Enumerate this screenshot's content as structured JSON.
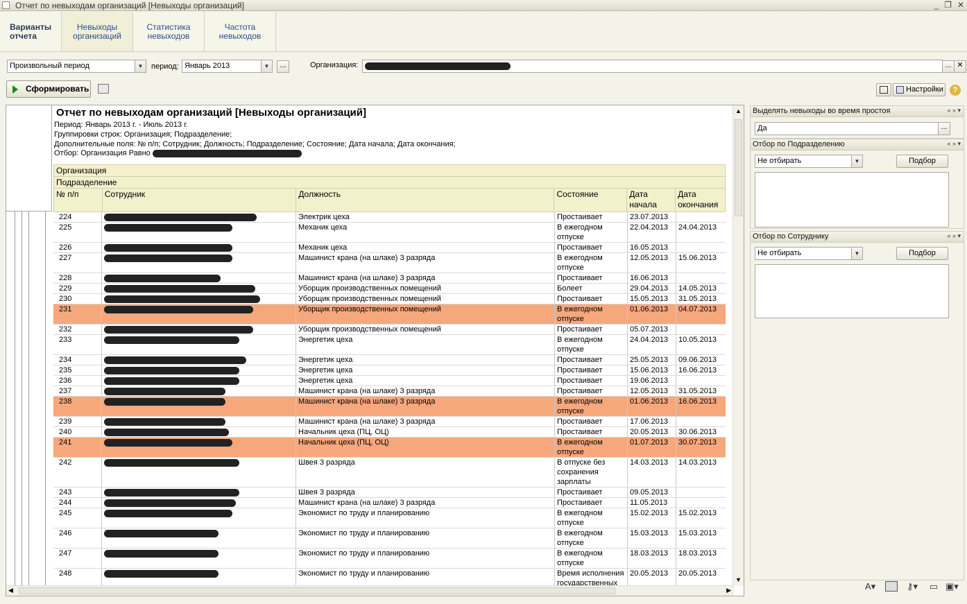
{
  "window": {
    "title": "Отчет по невыходам организаций [Невыходы организаций]",
    "buttons": [
      "_",
      "❐",
      "✕"
    ]
  },
  "tabs": [
    {
      "label": "Варианты отчета"
    },
    {
      "label": "Невыходы организаций"
    },
    {
      "label": "Статистика невыходов"
    },
    {
      "label": "Частота невыходов"
    }
  ],
  "filters": {
    "period_type": "Произвольный период",
    "period_label": "период:",
    "period_value": "Январь 2013",
    "ellipsis": "...",
    "org_label": "Организация:",
    "clear": "✕"
  },
  "toolbar": {
    "generate": "Сформировать",
    "settings": "Настройки",
    "help": "?"
  },
  "report": {
    "title": "Отчет по невыходам организаций [Невыходы организаций]",
    "period": "Период: Январь 2013 г. - Июль 2013 г.",
    "groupings": "Группировки строк: Организация; Подразделение;",
    "extra_fields": "Дополнительные поля: № п/п; Сотрудник; Должность; Подразделение; Состояние; Дата начала; Дата окончания;",
    "filter": "Отбор: Организация Равно",
    "group1": "Организация",
    "group2": "Подразделение",
    "columns": [
      "№ п/п",
      "Сотрудник",
      "Должность",
      "Состояние",
      "Дата начала",
      "Дата окончания"
    ],
    "rows": [
      {
        "n": "224",
        "pos": "Электрик цеха",
        "state": "Простаивает",
        "start": "23.07.2013",
        "end": "",
        "w": 220,
        "h": 1,
        "hl": false
      },
      {
        "n": "225",
        "pos": "Механик цеха",
        "state": "В ежегодном отпуске",
        "start": "22.04.2013",
        "end": "24.04.2013",
        "w": 185,
        "h": 2,
        "hl": false
      },
      {
        "n": "226",
        "pos": "Механик цеха",
        "state": "Простаивает",
        "start": "16.05.2013",
        "end": "",
        "w": 185,
        "h": 1,
        "hl": false
      },
      {
        "n": "227",
        "pos": "Машинист крана (на шлаке) 3 разряда",
        "state": "В ежегодном отпуске",
        "start": "12.05.2013",
        "end": "15.06.2013",
        "w": 185,
        "h": 2,
        "hl": false
      },
      {
        "n": "228",
        "pos": "Машинист крана (на шлаке) 3 разряда",
        "state": "Простаивает",
        "start": "16.06.2013",
        "end": "",
        "w": 168,
        "h": 1,
        "hl": false
      },
      {
        "n": "229",
        "pos": "Уборщик производственных помещений",
        "state": "Болеет",
        "start": "29.04.2013",
        "end": "14.05.2013",
        "w": 218,
        "h": 1,
        "hl": false
      },
      {
        "n": "230",
        "pos": "Уборщик производственных помещений",
        "state": "Простаивает",
        "start": "15.05.2013",
        "end": "31.05.2013",
        "w": 225,
        "h": 1,
        "hl": false
      },
      {
        "n": "231",
        "pos": "Уборщик производственных помещений",
        "state": "В ежегодном отпуске",
        "start": "01.06.2013",
        "end": "04.07.2013",
        "w": 215,
        "h": 2,
        "hl": true
      },
      {
        "n": "232",
        "pos": "Уборщик производственных помещений",
        "state": "Простаивает",
        "start": "05.07.2013",
        "end": "",
        "w": 215,
        "h": 1,
        "hl": false
      },
      {
        "n": "233",
        "pos": "Энергетик цеха",
        "state": "В ежегодном отпуске",
        "start": "24.04.2013",
        "end": "10.05.2013",
        "w": 195,
        "h": 2,
        "hl": false
      },
      {
        "n": "234",
        "pos": "Энергетик цеха",
        "state": "Простаивает",
        "start": "25.05.2013",
        "end": "09.06.2013",
        "w": 205,
        "h": 1,
        "hl": false
      },
      {
        "n": "235",
        "pos": "Энергетик цеха",
        "state": "Простаивает",
        "start": "15.06.2013",
        "end": "16.06.2013",
        "w": 195,
        "h": 1,
        "hl": false
      },
      {
        "n": "236",
        "pos": "Энергетик цеха",
        "state": "Простаивает",
        "start": "19.06.2013",
        "end": "",
        "w": 195,
        "h": 1,
        "hl": false
      },
      {
        "n": "237",
        "pos": "Машинист крана (на шлаке) 3 разряда",
        "state": "Простаивает",
        "start": "12.05.2013",
        "end": "31.05.2013",
        "w": 175,
        "h": 1,
        "hl": false
      },
      {
        "n": "238",
        "pos": "Машинист крана (на шлаке) 3 разряда",
        "state": "В ежегодном отпуске",
        "start": "01.06.2013",
        "end": "16.06.2013",
        "w": 175,
        "h": 2,
        "hl": true
      },
      {
        "n": "239",
        "pos": "Машинист крана (на шлаке) 3 разряда",
        "state": "Простаивает",
        "start": "17.06.2013",
        "end": "",
        "w": 175,
        "h": 1,
        "hl": false
      },
      {
        "n": "240",
        "pos": "Начальник цеха (ПЦ, ОЦ)",
        "state": "Простаивает",
        "start": "20.05.2013",
        "end": "30.06.2013",
        "w": 180,
        "h": 1,
        "hl": false
      },
      {
        "n": "241",
        "pos": "Начальник цеха (ПЦ, ОЦ)",
        "state": "В ежегодном отпуске",
        "start": "01.07.2013",
        "end": "30.07.2013",
        "w": 185,
        "h": 2,
        "hl": true
      },
      {
        "n": "242",
        "pos": "Швея 3 разряда",
        "state": "В отпуске без сохранения зарплаты",
        "start": "14.03.2013",
        "end": "14.03.2013",
        "w": 195,
        "h": 3,
        "hl": false
      },
      {
        "n": "243",
        "pos": "Швея 3 разряда",
        "state": "Простаивает",
        "start": "09.05.2013",
        "end": "",
        "w": 195,
        "h": 1,
        "hl": false
      },
      {
        "n": "244",
        "pos": "Машинист крана (на шлаке) 3 разряда",
        "state": "Простаивает",
        "start": "11.05.2013",
        "end": "",
        "w": 190,
        "h": 1,
        "hl": false
      },
      {
        "n": "245",
        "pos": "Экономист по труду и планированию",
        "state": "В ежегодном отпуске",
        "start": "15.02.2013",
        "end": "15.02.2013",
        "w": 185,
        "h": 2,
        "hl": false
      },
      {
        "n": "246",
        "pos": "Экономист по труду и планированию",
        "state": "В ежегодном отпуске",
        "start": "15.03.2013",
        "end": "15.03.2013",
        "w": 165,
        "h": 2,
        "hl": false
      },
      {
        "n": "247",
        "pos": "Экономист по труду и планированию",
        "state": "В ежегодном отпуске",
        "start": "18.03.2013",
        "end": "18.03.2013",
        "w": 165,
        "h": 2,
        "hl": false
      },
      {
        "n": "248",
        "pos": "Экономист по труду и планированию",
        "state": "Время исполнения государственных",
        "start": "20.05.2013",
        "end": "20.05.2013",
        "w": 165,
        "h": 2,
        "hl": false
      }
    ]
  },
  "panels": {
    "idle": {
      "title": "Выделять невыходы во время  простоя",
      "value": "Да",
      "ellipsis": "..."
    },
    "dept": {
      "title": "Отбор по Подразделению",
      "value": "Не отбирать",
      "pick": "Подбор"
    },
    "emp": {
      "title": "Отбор по Сотруднику",
      "value": "Не отбирать",
      "pick": "Подбор"
    },
    "icons": "« » ▾"
  },
  "colors": {
    "highlight": "#f7a77c",
    "header": "#f3f0cc",
    "tab_text": "#2a4f86"
  }
}
